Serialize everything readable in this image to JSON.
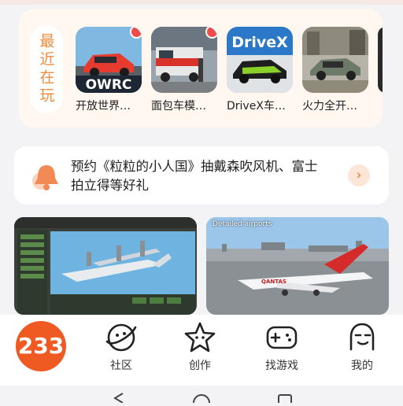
{
  "recent": {
    "label": "最近在玩",
    "games": [
      {
        "name": "开放世界…",
        "icon_text": "OWRC",
        "has_dot": true
      },
      {
        "name": "面包车模…",
        "icon_text": "",
        "has_dot": true
      },
      {
        "name": "DriveX车…",
        "icon_text": "DriveX",
        "has_dot": false
      },
      {
        "name": "火力全开…",
        "icon_text": "",
        "has_dot": false
      }
    ]
  },
  "reservation": {
    "text": "预约《粒粒的小人国》抽戴森吹风机、富士拍立得等好礼"
  },
  "screenshots": {
    "second_caption": "Detailed airports"
  },
  "nav": {
    "logo": "233",
    "items": [
      {
        "label": "社区",
        "icon": "planet-face-icon"
      },
      {
        "label": "创作",
        "icon": "star-face-icon"
      },
      {
        "label": "找游戏",
        "icon": "gamepad-icon"
      },
      {
        "label": "我的",
        "icon": "person-face-icon"
      }
    ]
  },
  "colors": {
    "accent": "#ef5a22",
    "recent_text": "#ef8b3b",
    "dot": "#f04a4a"
  }
}
